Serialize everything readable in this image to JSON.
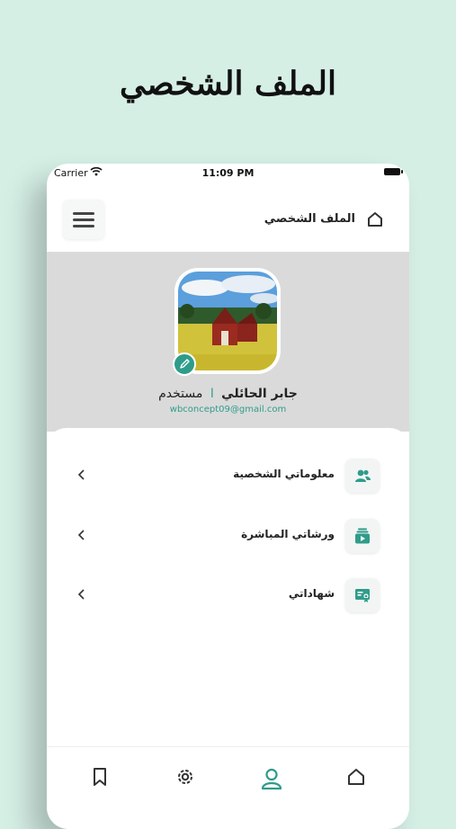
{
  "page_heading": "الملف الشخصي",
  "status_bar": {
    "carrier": "Carrier",
    "time": "11:09 PM"
  },
  "app_bar": {
    "title": "الملف الشخصي",
    "leading_icon": "home-icon",
    "menu_icon": "hamburger-menu-icon"
  },
  "profile": {
    "name": "جابر الحائلي",
    "role": "مستخدم",
    "separator": "ا",
    "email": "wbconcept09@gmail.com",
    "avatar_icon": "barn-landscape-photo",
    "edit_icon": "pencil-icon"
  },
  "menu": {
    "items": [
      {
        "label": "معلوماتي الشخصية",
        "icon": "users-icon"
      },
      {
        "label": "ورشاتي المباشرة",
        "icon": "live-video-icon"
      },
      {
        "label": "شهاداتي",
        "icon": "certificate-icon"
      }
    ]
  },
  "tab_bar": {
    "tabs": [
      {
        "icon": "home-icon",
        "active": false
      },
      {
        "icon": "user-icon",
        "active": true
      },
      {
        "icon": "gear-icon",
        "active": false
      },
      {
        "icon": "bookmark-icon",
        "active": false
      }
    ]
  },
  "colors": {
    "accent": "#2f9c8a",
    "background": "#d5efe5",
    "header_band": "#dadada"
  }
}
